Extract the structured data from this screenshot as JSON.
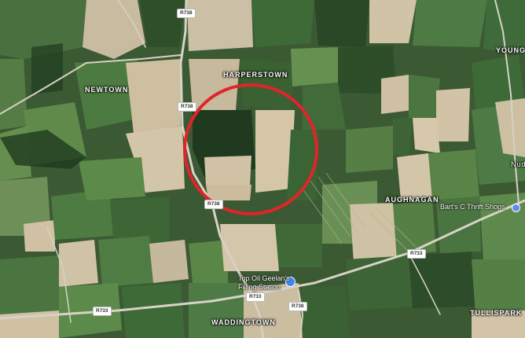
{
  "colors": {
    "ring": "#e3232b",
    "pin": "#4285f4",
    "road": "#d7d2c6"
  },
  "places": {
    "newtown": "NEWTOWN",
    "harperstown": "HARPERSTOWN",
    "aughnagan": "AUGHNAGAN",
    "waddingtown": "WADDINGTOWN",
    "tullispark": "TULLISPARK",
    "youngs": "YOUNGS",
    "nud": "Nud"
  },
  "roads": {
    "r738_top": "R738",
    "r738_mid": "R738",
    "r738_bottom": "R738",
    "r733_left": "R733",
    "r733_mid": "R733",
    "r733_right": "R733",
    "r738_junction": "R738"
  },
  "pois": {
    "filling_line1": "Top Oil Geelan's",
    "filling_line2": "Filling Station",
    "thrift": "Bart's C Thrift Shops"
  },
  "icons": {
    "filling_station": "fuel-pin-icon",
    "thrift_shop": "shop-pin-icon"
  }
}
